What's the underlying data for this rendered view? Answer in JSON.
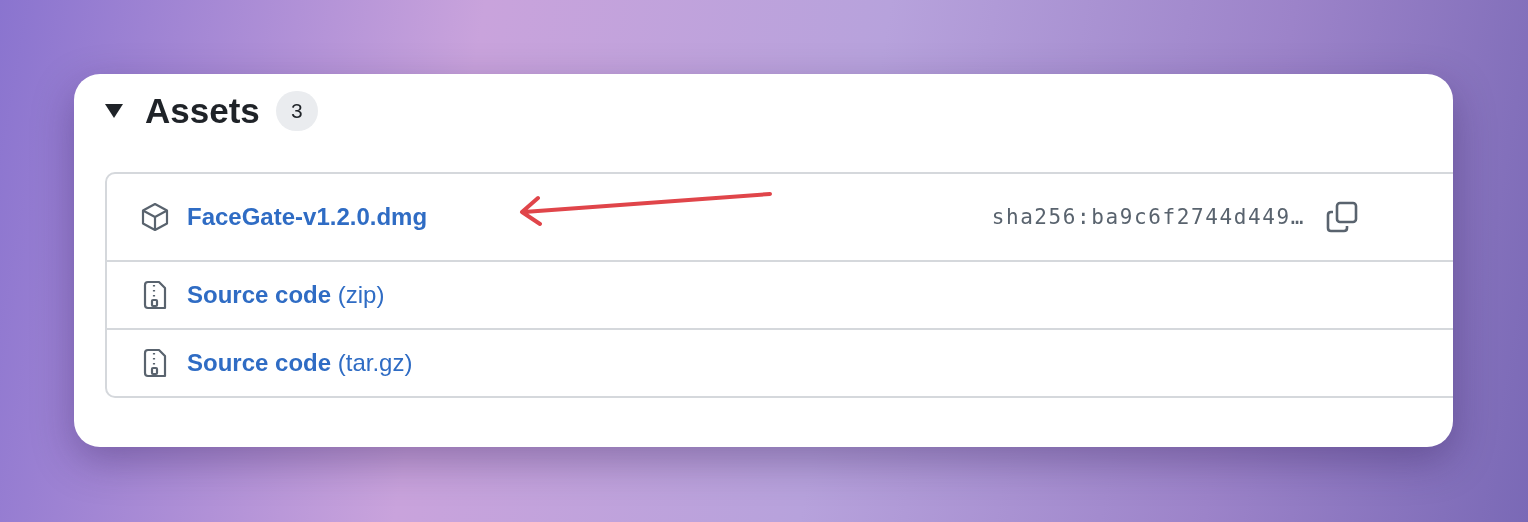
{
  "section": {
    "title": "Assets",
    "count": "3",
    "expanded": true
  },
  "assets": [
    {
      "kind": "package",
      "name": "FaceGate-v1.2.0.dmg",
      "digest": "sha256:ba9c6f2744d449…"
    },
    {
      "kind": "archive",
      "name": "**Source code** (zip)"
    },
    {
      "kind": "archive",
      "name": "**Source code** (tar.gz)"
    }
  ]
}
